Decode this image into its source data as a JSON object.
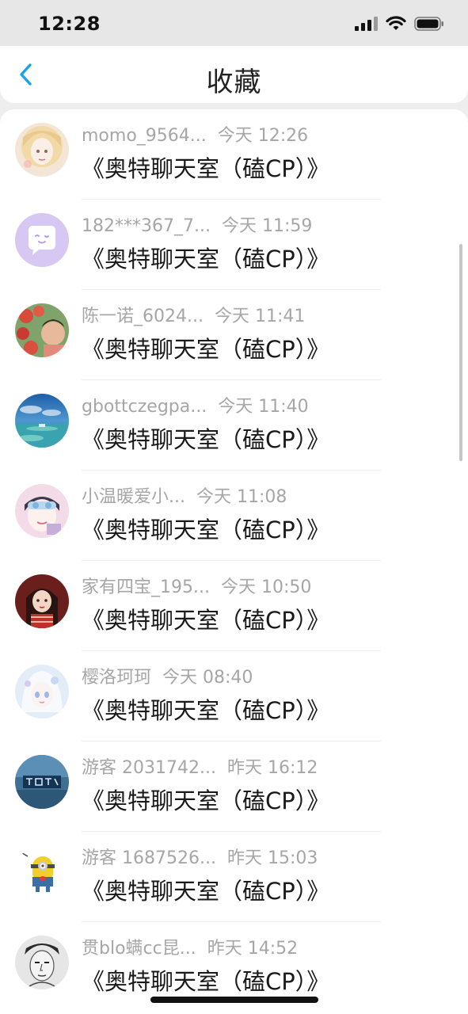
{
  "status_bar": {
    "time": "12:28",
    "icons": [
      "signal-icon",
      "wifi-icon",
      "battery-icon"
    ]
  },
  "header": {
    "title": "收藏",
    "back_icon": "chevron-left-icon",
    "accent": "#1aa3e8"
  },
  "items": [
    {
      "user": "momo_9564...",
      "time": "今天 12:26",
      "title": "《奥特聊天室（磕CP）》",
      "avatar": "girl-portrait-light"
    },
    {
      "user": "182***367_7...",
      "time": "今天 11:59",
      "title": "《奥特聊天室（磕CP）》",
      "avatar": "purple-chat-bubble"
    },
    {
      "user": "陈一诺_6024...",
      "time": "今天 11:41",
      "title": "《奥特聊天室（磕CP）》",
      "avatar": "child-with-flowers"
    },
    {
      "user": "gbottczegpa...",
      "time": "今天 11:40",
      "title": "《奥特聊天室（磕CP）》",
      "avatar": "sea-island"
    },
    {
      "user": "小温暖爱小...",
      "time": "今天 11:08",
      "title": "《奥特聊天室（磕CP）》",
      "avatar": "anime-girl-goggles"
    },
    {
      "user": "家有四宝_195...",
      "time": "今天 10:50",
      "title": "《奥特聊天室（磕CP）》",
      "avatar": "girl-red-sweater"
    },
    {
      "user": "樱洛珂珂",
      "time": "今天 08:40",
      "title": "《奥特聊天室（磕CP）》",
      "avatar": "anime-girl-white-hair"
    },
    {
      "user": "游客 2031742...",
      "time": "昨天 16:12",
      "title": "《奥特聊天室（磕CP）》",
      "avatar": "blue-text-emblem"
    },
    {
      "user": "游客 1687526...",
      "time": "昨天 15:03",
      "title": "《奥特聊天室（磕CP）》",
      "avatar": "minion-sticker"
    },
    {
      "user": "贯blo螨cc昆...",
      "time": "昨天 14:52",
      "title": "《奥特聊天室（磕CP）》",
      "avatar": "grey-sketch-portrait"
    }
  ]
}
